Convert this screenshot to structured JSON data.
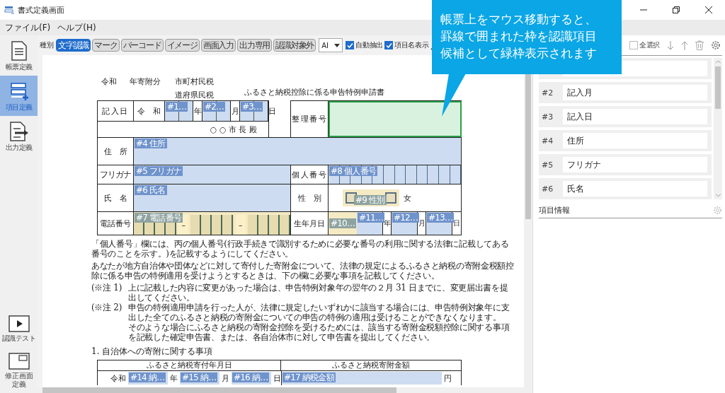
{
  "window": {
    "title": "書式定義画面"
  },
  "menu": [
    "ファイル(F)",
    "ヘルプ(H)"
  ],
  "sidebar": {
    "top": [
      {
        "label": "帳票定義",
        "kind": "form",
        "selected": false
      },
      {
        "label": "項目定義",
        "kind": "items",
        "selected": true
      },
      {
        "label": "出力定義",
        "kind": "output",
        "selected": false
      }
    ],
    "bottom": [
      {
        "label": "認識テスト",
        "kind": "test",
        "selected": false
      },
      {
        "label": "修正画面定義",
        "kind": "screen",
        "selected": false
      }
    ]
  },
  "toolbar": {
    "type_label": "種別",
    "types": [
      {
        "label": "文字認識",
        "selected": true
      },
      {
        "label": "マーク",
        "selected": false
      },
      {
        "label": "バーコード",
        "selected": false
      },
      {
        "label": "イメージ",
        "selected": false
      },
      {
        "label": "画面入力",
        "selected": false
      },
      {
        "label": "出力専用",
        "selected": false
      },
      {
        "label": "認識対象外",
        "selected": false
      }
    ],
    "engine": "AI",
    "auto_extract": {
      "label": "自動抽出",
      "checked": true
    },
    "show_names": {
      "label": "項目名表示",
      "checked": true
    }
  },
  "callout": {
    "lines": [
      "帳票上をマウス移動すると、",
      "罫線で囲まれた枠を認識項目",
      "候補として緑枠表示されます"
    ]
  },
  "document": {
    "header": {
      "era": "令和",
      "year_suffix": "年寄附分",
      "taxes": [
        "市町村民税",
        "道府県民税"
      ],
      "title": "ふるさと納税控除に係る申告特例申請書"
    },
    "entry_date": {
      "label": "記入日",
      "era": "令　和",
      "parts": [
        {
          "tag": "#1…",
          "unit": "年"
        },
        {
          "tag": "#2…",
          "unit": "月"
        },
        {
          "tag": "#3…",
          "unit": "日"
        }
      ]
    },
    "addressee": "○ ○ 市 長 殿",
    "reference": {
      "label": "整理番号",
      "candidate": true
    },
    "address": {
      "label": "住　所",
      "tag": "#4 住所",
      "kind": "text"
    },
    "furigana": {
      "label": "フリガナ",
      "tag": "#5 フリガナ",
      "kind": "text"
    },
    "my_number": {
      "label": "個人番号",
      "tag": "#8 個人番号",
      "kind": "text"
    },
    "name": {
      "label": "氏　名",
      "tag": "#6 氏名",
      "kind": "text"
    },
    "gender": {
      "label": "性　別",
      "tag": "#9 性別",
      "kind": "mark",
      "option": "女"
    },
    "phone": {
      "label": "電話番号",
      "tag": "#7 電話番号",
      "kind": "mark",
      "separators": [
        "–",
        "–"
      ]
    },
    "birth": {
      "label": "生年月日",
      "parts": [
        {
          "tag": "#10…",
          "kind": "mark"
        },
        {
          "tag": "#11…",
          "kind": "text",
          "unit": "年"
        },
        {
          "tag": "#12…",
          "kind": "text",
          "unit": "月"
        },
        {
          "tag": "#13…",
          "kind": "text",
          "unit": "日"
        }
      ]
    },
    "paragraphs": [
      "「個人番号」欄には、丙の個人番号(行政手続きで識別するために必要な番号の利用に関する法律に記載してある番号のことを示す。)を記載するようにしてください。",
      "あなたが地方自治体や団体などに対して寄付した寄附金について、法律の規定によるふるさと納税の寄附金税額控除に係る申告の特例適用を受けようとするときは、下の欄に必要な事項を記載してください。"
    ],
    "notes": [
      {
        "mark": "(※注 1)",
        "text": "上に記載した内容に変更があった場合は、申告特例対象年の翌年の２月 31 日までに、変更届出書を提出してください。"
      },
      {
        "mark": "(※注 2)",
        "text": "申告の特例適用申請を行った人が、法律に規定したいずれかに該当する場合には、申告特例対象年に支出した全てのふるさと納税の寄附金についての申告の特例の適用は受けることができなくなります。"
      },
      {
        "text": "そのような場合にふるさと納税の寄附金控除を受けるためには、該当する寄附金税額控除に関する事項を記載した確定申告書、または、各自治体市に対して申告書を提出してください。"
      }
    ],
    "section_title": "1. 自治体への寄附に関する事項",
    "donation": {
      "headers": [
        "ふるさと納税寄付年月日",
        "ふるさと納税寄附金額"
      ],
      "era": "令和",
      "date_parts": [
        {
          "tag": "#14 納…",
          "unit": "年"
        },
        {
          "tag": "#15 納…",
          "unit": "月"
        },
        {
          "tag": "#16 納…",
          "unit": "日"
        }
      ],
      "amount_tag": "#17 納税金額",
      "currency": "円"
    }
  },
  "item_list": {
    "select_all": {
      "label": "全選択",
      "checked": false
    },
    "items": [
      {
        "number": "#2",
        "name": "記入月"
      },
      {
        "number": "#3",
        "name": "記入日"
      },
      {
        "number": "#4",
        "name": "住所"
      },
      {
        "number": "#5",
        "name": "フリガナ"
      },
      {
        "number": "#6",
        "name": "氏名"
      }
    ]
  },
  "item_info": {
    "title": "項目情報"
  }
}
